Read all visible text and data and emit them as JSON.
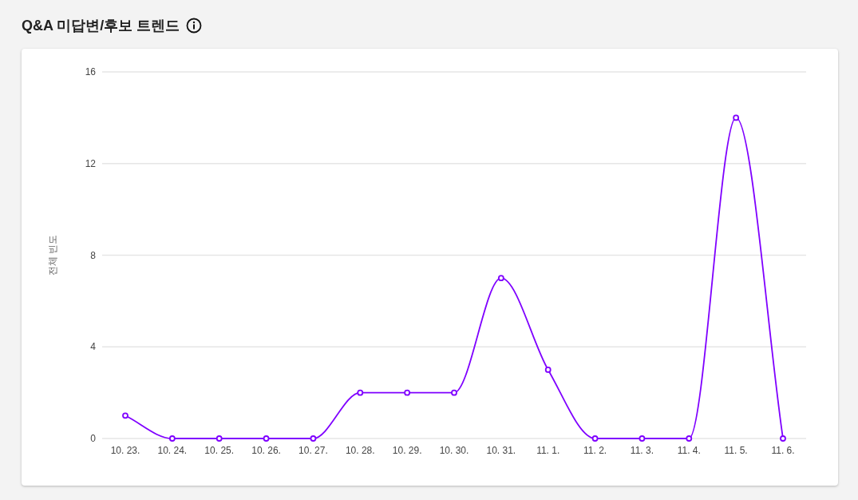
{
  "title": "Q&A 미답변/후보 트렌드",
  "chart": {
    "chart_data": {
      "type": "line",
      "ylabel": "전체 빈도",
      "categories": [
        "10. 23.",
        "10. 24.",
        "10. 25.",
        "10. 26.",
        "10. 27.",
        "10. 28.",
        "10. 29.",
        "10. 30.",
        "10. 31.",
        "11. 1.",
        "11. 2.",
        "11. 3.",
        "11. 4.",
        "11. 5.",
        "11. 6."
      ],
      "ylim": [
        0,
        16
      ],
      "grid": true,
      "yticks": [
        0,
        4,
        8,
        12,
        16
      ],
      "series": [
        {
          "color": "#7f00ff",
          "marker": true,
          "values": [
            1,
            0,
            0,
            0,
            0,
            2,
            2,
            2,
            7,
            3,
            0,
            0,
            0,
            14,
            0
          ]
        }
      ]
    }
  }
}
